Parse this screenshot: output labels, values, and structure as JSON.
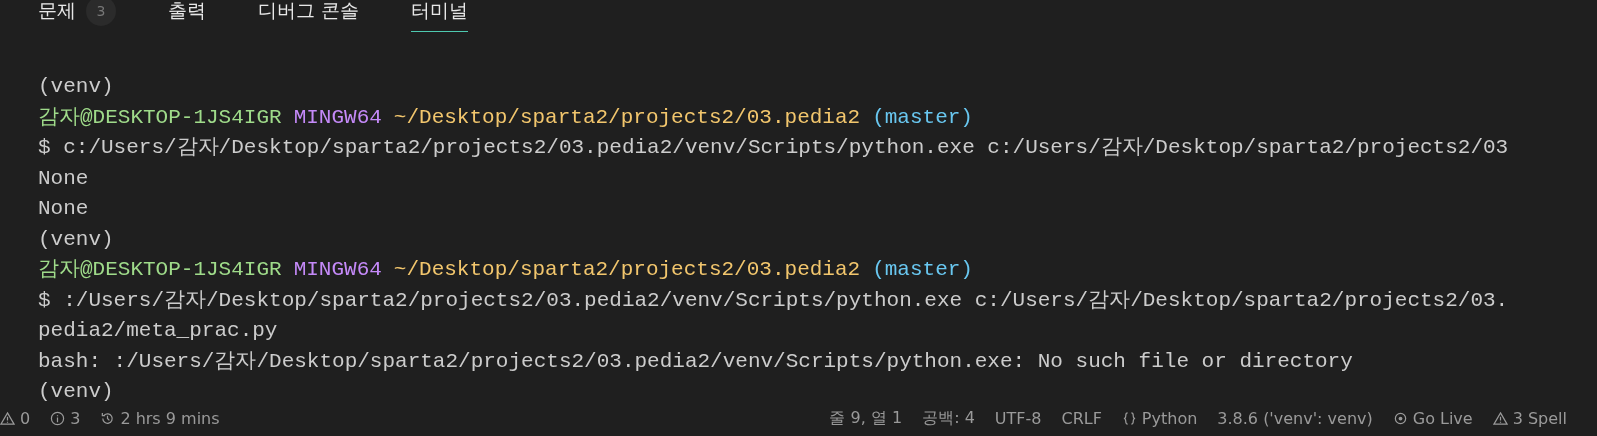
{
  "tabs": [
    {
      "label": "문제",
      "badge": "3",
      "selected": false
    },
    {
      "label": "출력",
      "selected": false
    },
    {
      "label": "디버그 콘솔",
      "selected": false
    },
    {
      "label": "터미널",
      "selected": true
    }
  ],
  "terminal": {
    "lines": [
      {
        "kind": "plain",
        "text": "(venv)"
      },
      {
        "kind": "prompt",
        "user": "감자@DESKTOP-1JS4IGR",
        "shell": "MINGW64",
        "path": "~/Desktop/sparta2/projects2/03.pedia2",
        "branch": "(master)"
      },
      {
        "kind": "plain",
        "text": "$ c:/Users/감자/Desktop/sparta2/projects2/03.pedia2/venv/Scripts/python.exe c:/Users/감자/Desktop/sparta2/projects2/03"
      },
      {
        "kind": "plain",
        "text": "None"
      },
      {
        "kind": "plain",
        "text": "None"
      },
      {
        "kind": "plain",
        "text": "(venv)"
      },
      {
        "kind": "prompt",
        "user": "감자@DESKTOP-1JS4IGR",
        "shell": "MINGW64",
        "path": "~/Desktop/sparta2/projects2/03.pedia2",
        "branch": "(master)"
      },
      {
        "kind": "plain",
        "text": "$ :/Users/감자/Desktop/sparta2/projects2/03.pedia2/venv/Scripts/python.exe c:/Users/감자/Desktop/sparta2/projects2/03."
      },
      {
        "kind": "plain",
        "text": "pedia2/meta_prac.py"
      },
      {
        "kind": "plain",
        "text": "bash: :/Users/감자/Desktop/sparta2/projects2/03.pedia2/venv/Scripts/python.exe: No such file or directory"
      },
      {
        "kind": "plain",
        "text": "(venv)"
      }
    ]
  },
  "status_bar": {
    "left": [
      {
        "kind": "warning",
        "text": "0"
      },
      {
        "kind": "info",
        "text": "3"
      },
      {
        "kind": "history",
        "text": "2 hrs 9 mins"
      }
    ],
    "right": [
      {
        "kind": "text",
        "text": "줄 9, 열 1"
      },
      {
        "kind": "text",
        "text": "공백: 4"
      },
      {
        "kind": "text",
        "text": "UTF-8"
      },
      {
        "kind": "text",
        "text": "CRLF"
      },
      {
        "kind": "braces",
        "text": "Python"
      },
      {
        "kind": "text",
        "text": "3.8.6 ('venv': venv)"
      },
      {
        "kind": "broadcast",
        "text": "Go Live"
      },
      {
        "kind": "warning",
        "text": "3 Spell"
      }
    ]
  }
}
